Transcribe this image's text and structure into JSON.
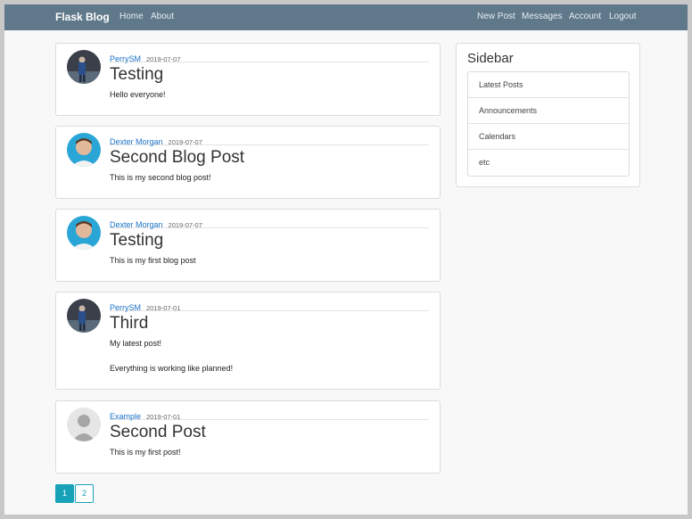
{
  "navbar": {
    "brand": "Flask Blog",
    "left_links": [
      "Home",
      "About"
    ],
    "right_links": [
      "New Post",
      "Messages",
      "Account",
      "Logout"
    ]
  },
  "posts": [
    {
      "author": "PerrySM",
      "date": "2019-07-07",
      "title": "Testing",
      "content": [
        "Hello everyone!"
      ],
      "avatar_icon": "person-photo-dark"
    },
    {
      "author": "Dexter Morgan",
      "date": "2019-07-07",
      "title": "Second Blog Post",
      "content": [
        "This is my second blog post!"
      ],
      "avatar_icon": "person-photo-blue"
    },
    {
      "author": "Dexter Morgan",
      "date": "2019-07-07",
      "title": "Testing",
      "content": [
        "This is my first blog post"
      ],
      "avatar_icon": "person-photo-blue"
    },
    {
      "author": "PerrySM",
      "date": "2019-07-01",
      "title": "Third",
      "content": [
        "My latest post!",
        "Everything is working like planned!"
      ],
      "avatar_icon": "person-photo-dark"
    },
    {
      "author": "Example",
      "date": "2019-07-01",
      "title": "Second Post",
      "content": [
        "This is my first post!"
      ],
      "avatar_icon": "default-user-icon"
    }
  ],
  "sidebar": {
    "title": "Sidebar",
    "items": [
      "Latest Posts",
      "Announcements",
      "Calendars",
      "etc"
    ]
  },
  "pagination": {
    "pages": [
      "1",
      "2"
    ],
    "active": "1"
  },
  "colors": {
    "navbar": "#5f788a",
    "link": "#1a73c8",
    "accent": "#17a2b8"
  }
}
